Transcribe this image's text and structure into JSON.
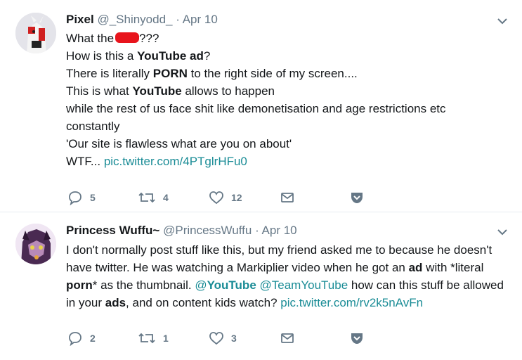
{
  "tweets": [
    {
      "name": "Pixel",
      "handle": "@_Shinyodd_",
      "separator": "·",
      "date": "Apr 10",
      "lines": {
        "l1_pre": "What the",
        "l1_post": "???",
        "l2_pre": "How is this a ",
        "l2_bold": "YouTube ad",
        "l2_post": "?",
        "l3_pre": "There is literally ",
        "l3_bold": "PORN",
        "l3_post": " to the right side of my screen....",
        "l4_pre": "This is what ",
        "l4_bold": "YouTube",
        "l4_post": " allows to happen",
        "l5": "while the rest of us face shit like demonetisation and age restrictions etc",
        "l6": "constantly",
        "l7": "'Our site is flawless what are you on about'",
        "l8_pre": "WTF... ",
        "l8_link": "pic.twitter.com/4PTglrHFu0"
      },
      "replies": "5",
      "retweets": "4",
      "likes": "12"
    },
    {
      "name": "Princess Wuffu~",
      "handle": "@PrincessWuffu",
      "separator": "·",
      "date": "Apr 10",
      "text": {
        "p1": "I don't normally post stuff like this, but my friend asked me to because he doesn't have twitter. He was watching a Markiplier video when he got an ",
        "b1": "ad",
        "p2": " with *literal ",
        "b2": "porn",
        "p3": "* as the thumbnail. ",
        "m1_at": "@",
        "m1_bold": "YouTube",
        "p4": " ",
        "m2": "@TeamYouTube",
        "p5": " how can this stuff be allowed in your ",
        "b3": "ads",
        "p6": ", and on content kids watch? ",
        "link": "pic.twitter.com/rv2k5nAvFn"
      },
      "replies": "2",
      "retweets": "1",
      "likes": "3"
    }
  ],
  "colors": {
    "link": "#1a8c96",
    "muted": "#657786",
    "censor": "#e8141c"
  }
}
